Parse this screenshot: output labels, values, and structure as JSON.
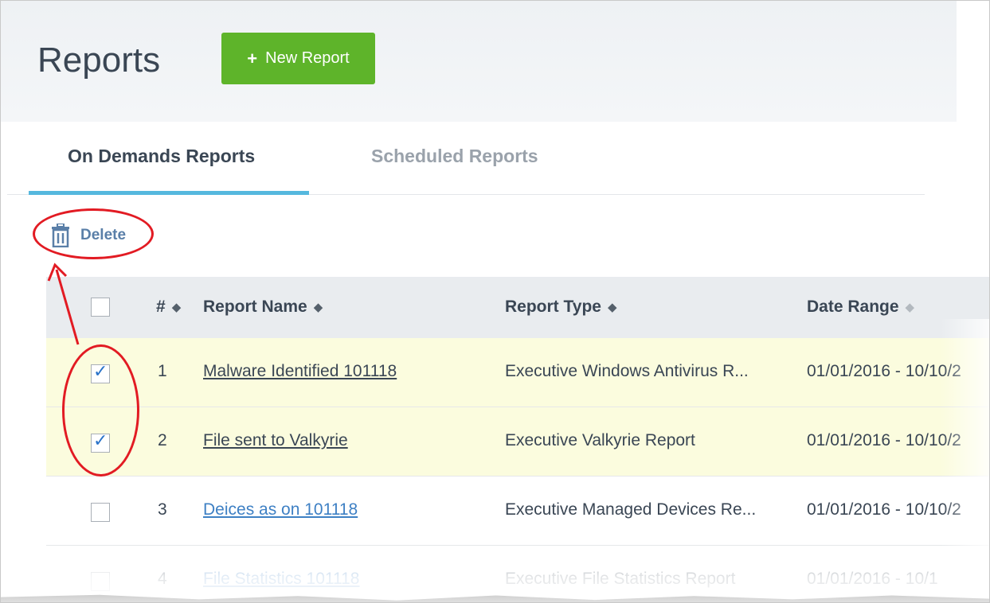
{
  "header": {
    "title": "Reports",
    "new_report_label": "New Report",
    "new_report_icon": "+"
  },
  "tabs": [
    {
      "label": "On Demands Reports",
      "active": true
    },
    {
      "label": "Scheduled Reports",
      "active": false
    }
  ],
  "toolbar": {
    "delete_label": "Delete"
  },
  "table": {
    "columns": [
      "#",
      "Report Name",
      "Report Type",
      "Date Range"
    ],
    "rows": [
      {
        "num": "1",
        "name": "Malware Identified 101118",
        "type": "Executive Windows Antivirus R...",
        "date": "01/01/2016 - 10/10/2",
        "checked": true
      },
      {
        "num": "2",
        "name": "File sent to Valkyrie",
        "type": "Executive Valkyrie Report",
        "date": "01/01/2016 - 10/10/2",
        "checked": true
      },
      {
        "num": "3",
        "name": "Deices as on 101118",
        "type": "Executive Managed Devices Re...",
        "date": "01/01/2016 - 10/10/2",
        "checked": false
      },
      {
        "num": "4",
        "name": "File Statistics 101118",
        "type": "Executive File Statistics Report",
        "date": "01/01/2016 - 10/1",
        "checked": false
      }
    ]
  },
  "colors": {
    "accent_green": "#5eb42a",
    "tab_underline": "#55b8de",
    "annotation_red": "#e21b23",
    "selected_row": "#fbfcde",
    "link_blue": "#3e80c4"
  }
}
